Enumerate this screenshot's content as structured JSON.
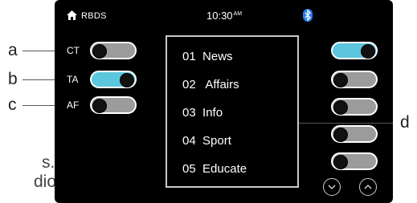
{
  "callouts": {
    "a": "a",
    "b": "b",
    "c": "c",
    "d": "d"
  },
  "page_text": {
    "line1": "s.",
    "line2": "dio"
  },
  "status": {
    "source": "RBDS",
    "time": "10:30",
    "ampm": "AM",
    "home_icon": "home-icon",
    "bluetooth_icon": "bluetooth-icon"
  },
  "toggles_left": [
    {
      "label": "CT",
      "state": "off"
    },
    {
      "label": "TA",
      "state": "on"
    },
    {
      "label": "AF",
      "state": "off"
    }
  ],
  "pty_list": [
    {
      "num": "01",
      "name": "News"
    },
    {
      "num": "02",
      "name": "Affairs"
    },
    {
      "num": "03",
      "name": "Info"
    },
    {
      "num": "04",
      "name": "Sport"
    },
    {
      "num": "05",
      "name": "Educate"
    }
  ],
  "toggles_right": [
    "on",
    "off",
    "off",
    "off",
    "off"
  ],
  "nav": {
    "down_icon": "chevron-down-icon",
    "up_icon": "chevron-up-icon"
  },
  "colors": {
    "toggle_on": "#5cc6dc",
    "toggle_off": "#9b9b9b",
    "screen_bg": "#000000"
  }
}
